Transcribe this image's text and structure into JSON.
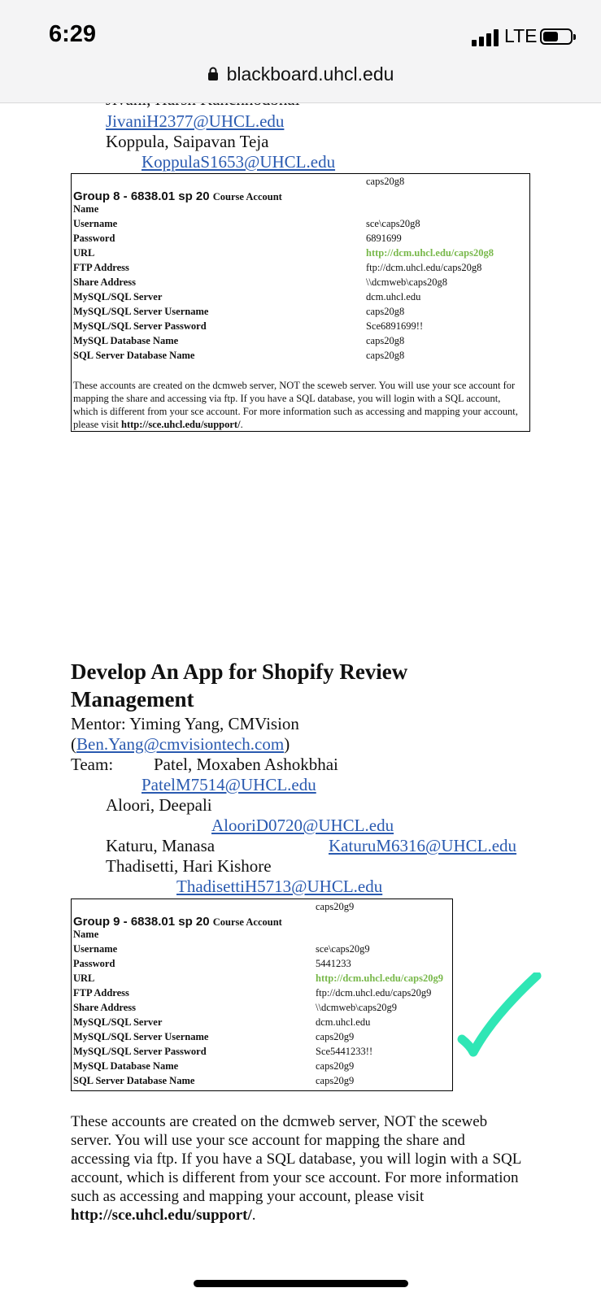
{
  "status": {
    "time": "6:29",
    "network": "LTE"
  },
  "browser": {
    "url": "blackboard.uhcl.edu"
  },
  "team8": {
    "cut_name": "Jivani, Harsh Kanchhodbhai",
    "email1": "JivaniH2377@UHCL.edu",
    "name2": "Koppula, Saipavan Teja",
    "email2": "KoppulaS1653@UHCL.edu"
  },
  "group8": {
    "name_value": "caps20g8",
    "group_label": "Group 8 - 6838.01 sp 20",
    "course_account": "Course Account",
    "name_label": "Name",
    "rows": [
      {
        "label": "Username",
        "value": "sce\\caps20g8"
      },
      {
        "label": "Password",
        "value": "6891699"
      },
      {
        "label": "URL",
        "value": "http://dcm.uhcl.edu/caps20g8"
      },
      {
        "label": "FTP Address",
        "value": "ftp://dcm.uhcl.edu/caps20g8"
      },
      {
        "label": "Share Address",
        "value": "\\\\dcmweb\\caps20g8"
      },
      {
        "label": "MySQL/SQL Server",
        "value": "dcm.uhcl.edu"
      },
      {
        "label": "MySQL/SQL Server Username",
        "value": "caps20g8"
      },
      {
        "label": "MySQL/SQL Server Password",
        "value": "Sce6891699!!"
      },
      {
        "label": "MySQL Database Name",
        "value": "caps20g8"
      },
      {
        "label": "SQL Server Database Name",
        "value": "caps20g8"
      }
    ],
    "note": "These accounts are created on the dcmweb server, NOT the sceweb server. You will use your sce account for mapping the share and accessing via ftp. If you have a SQL database, you will login with a SQL account, which is different from your sce account. For more information such as accessing and mapping your account, please visit ",
    "note_link": "http://sce.uhcl.edu/support/",
    "note_end": "."
  },
  "project9": {
    "title_line1": "Develop An App for Shopify Review",
    "title_line2": "Management",
    "mentor": "Mentor: Yiming Yang, CMVision",
    "mentor_email": "Ben.Yang@cmvisiontech.com",
    "team_label": "Team:",
    "members": [
      {
        "name": "Patel, Moxaben Ashokbhai",
        "email": "PatelM7514@UHCL.edu"
      },
      {
        "name": "Aloori, Deepali",
        "email": "AlooriD0720@UHCL.edu"
      },
      {
        "name": "Katuru, Manasa",
        "email": "KaturuM6316@UHCL.edu"
      },
      {
        "name": "Thadisetti, Hari Kishore",
        "email": "ThadisettiH5713@UHCL.edu"
      }
    ]
  },
  "group9": {
    "name_value": "caps20g9",
    "group_label": "Group 9 - 6838.01 sp 20",
    "course_account": "Course Account",
    "name_label": "Name",
    "rows": [
      {
        "label": "Username",
        "value": "sce\\caps20g9"
      },
      {
        "label": "Password",
        "value": "5441233"
      },
      {
        "label": "URL",
        "value": "http://dcm.uhcl.edu/caps20g9"
      },
      {
        "label": "FTP Address",
        "value": "ftp://dcm.uhcl.edu/caps20g9"
      },
      {
        "label": "Share Address",
        "value": "\\\\dcmweb\\caps20g9"
      },
      {
        "label": "MySQL/SQL Server",
        "value": "dcm.uhcl.edu"
      },
      {
        "label": "MySQL/SQL Server Username",
        "value": "caps20g9"
      },
      {
        "label": "MySQL/SQL Server Password",
        "value": "Sce5441233!!"
      },
      {
        "label": "MySQL Database Name",
        "value": "caps20g9"
      },
      {
        "label": "SQL Server Database Name",
        "value": "caps20g9"
      }
    ],
    "note": "These accounts are created on the dcmweb server, NOT the sceweb server. You will use your sce account for mapping the share and accessing via ftp. If you have a SQL database, you will login with a SQL account, which is different from your sce account. For more information such as accessing and mapping your account, please visit ",
    "note_link": "http://sce.uhcl.edu/support/",
    "note_end": "."
  },
  "colors": {
    "link": "#2a5ab0",
    "url_green": "#78b84a",
    "checkmark": "#2fe6b5"
  },
  "icons": {
    "lock": "lock-icon",
    "check": "checkmark-icon"
  }
}
